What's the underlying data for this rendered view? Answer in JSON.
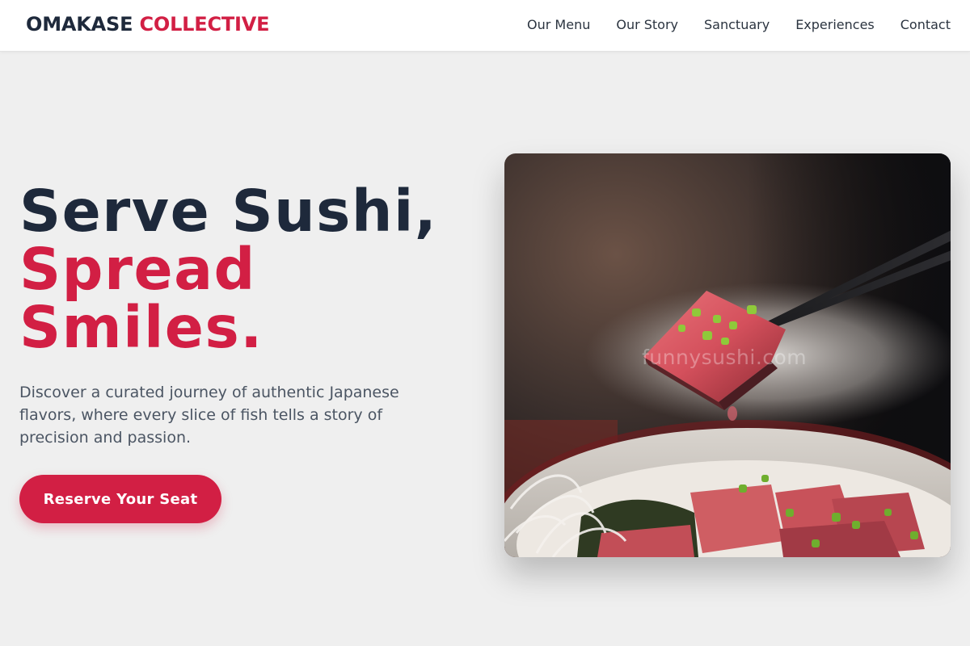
{
  "brand": {
    "name_part1": "OMAKASE",
    "name_part2": "COLLECTIVE"
  },
  "nav": {
    "items": [
      {
        "label": "Our Menu"
      },
      {
        "label": "Our Story"
      },
      {
        "label": "Sanctuary"
      },
      {
        "label": "Experiences"
      },
      {
        "label": "Contact"
      }
    ]
  },
  "hero": {
    "title_line1": "Serve Sushi,",
    "title_line2": "Spread",
    "title_line3": "Smiles.",
    "description": "Discover a curated journey of authentic Japanese flavors, where every slice of fish tells a story of precision and passion.",
    "cta_label": "Reserve Your Seat",
    "image_watermark": "funnysushi.com"
  },
  "colors": {
    "accent": "#d21f44",
    "heading": "#1e293b",
    "body_text": "#4b5563",
    "background": "#efefef"
  }
}
